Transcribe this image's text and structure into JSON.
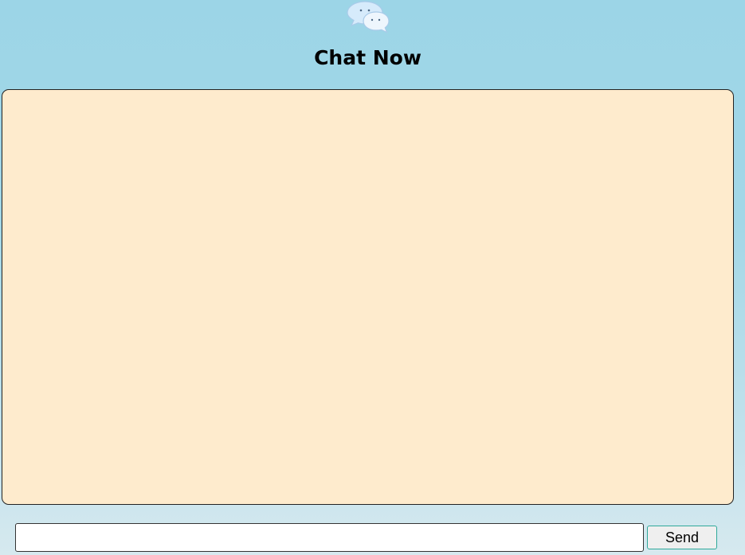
{
  "header": {
    "icon": "chat-bubbles-icon",
    "title": "Chat Now"
  },
  "chat": {
    "messages": []
  },
  "composer": {
    "input_value": "",
    "placeholder": "",
    "send_label": "Send"
  },
  "colors": {
    "background_top": "#9cd5e7",
    "background_bottom": "#d6e9ef",
    "chat_panel": "#feebcd",
    "send_button_border": "#2fa99a"
  }
}
